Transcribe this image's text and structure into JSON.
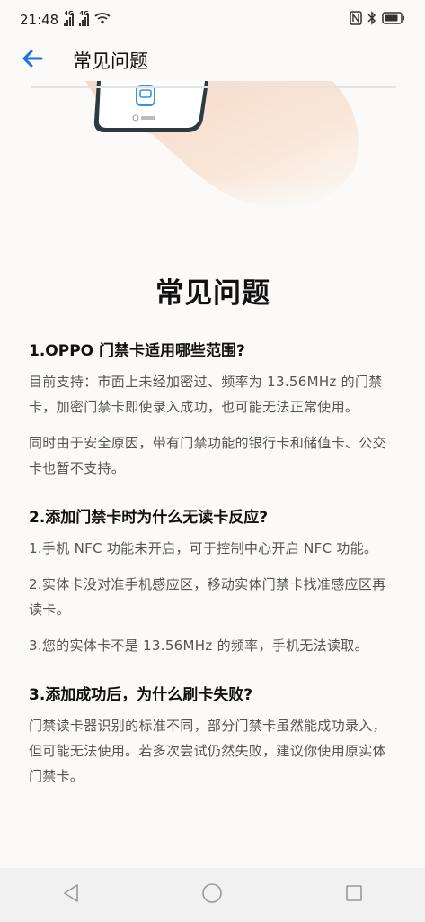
{
  "status_bar": {
    "time": "21:48",
    "sim1": "4G",
    "sim2": "4G",
    "icons": [
      "signal-icon",
      "signal-icon",
      "wifi-icon",
      "nfc-icon",
      "bluetooth-icon",
      "battery-icon"
    ]
  },
  "header": {
    "back_icon": "arrow-left-icon",
    "title": "常见问题"
  },
  "main": {
    "heading": "常见问题",
    "faqs": [
      {
        "question": "1.OPPO 门禁卡适用哪些范围?",
        "paragraphs": [
          "目前支持：市面上未经加密过、频率为 13.56MHz 的门禁卡，加密门禁卡即使录入成功，也可能无法正常使用。",
          "同时由于安全原因，带有门禁功能的银行卡和储值卡、公交卡也暂不支持。"
        ]
      },
      {
        "question": "2.添加门禁卡时为什么无读卡反应?",
        "paragraphs": [
          "1.手机 NFC 功能未开启，可于控制中心开启 NFC 功能。",
          "2.实体卡没对准手机感应区，移动实体门禁卡找准感应区再读卡。",
          "3.您的实体卡不是 13.56MHz 的频率，手机无法读取。"
        ]
      },
      {
        "question": "3.添加成功后，为什么刷卡失败?",
        "paragraphs": [
          "门禁读卡器识别的标准不同，部分门禁卡虽然能成功录入，但可能无法使用。若多次尝试仍然失败，建议你使用原实体门禁卡。"
        ]
      }
    ]
  },
  "nav_bar": {
    "icons": [
      "back-triangle-icon",
      "home-circle-icon",
      "recents-square-icon"
    ]
  },
  "colors": {
    "accent": "#1a73e8",
    "background": "#fbfaf8",
    "nav_background": "#f1f1f1"
  }
}
